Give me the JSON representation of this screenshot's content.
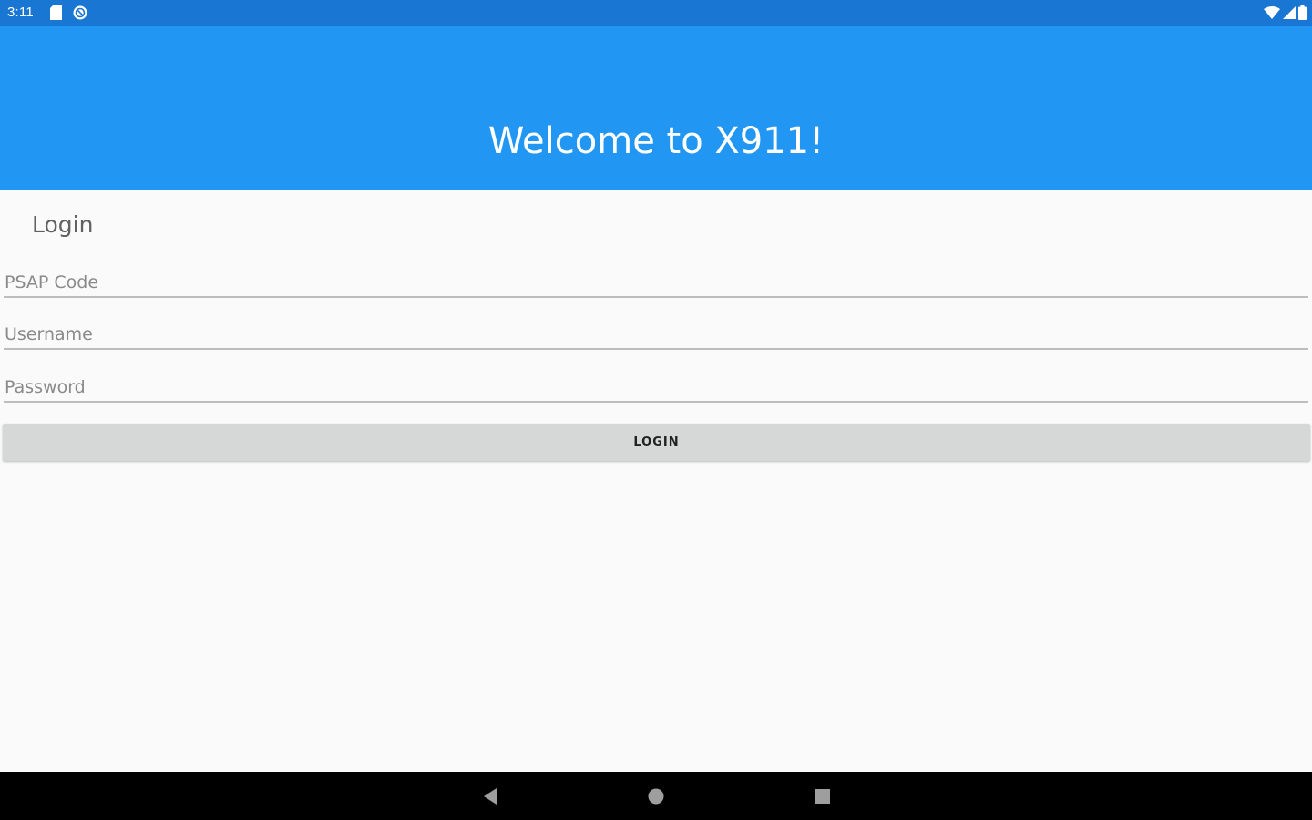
{
  "status_bar": {
    "time": "3:11",
    "left_icons": [
      "sd-card-icon",
      "blocked-icon"
    ],
    "right_icons": [
      "wifi-icon",
      "cellular-signal-icon",
      "battery-icon"
    ]
  },
  "app_bar": {
    "title": "Welcome to X911!"
  },
  "login_form": {
    "heading": "Login",
    "psap_code": {
      "placeholder": "PSAP Code",
      "value": ""
    },
    "username": {
      "placeholder": "Username",
      "value": ""
    },
    "password": {
      "placeholder": "Password",
      "value": ""
    },
    "submit_label": "LOGIN"
  },
  "nav_bar": {
    "buttons": [
      "back-icon",
      "home-icon",
      "recents-icon"
    ]
  },
  "colors": {
    "status_bar": "#1976d2",
    "app_bar": "#2196f3",
    "background": "#fafafa",
    "button": "#d6d7d7",
    "nav_bar": "#000000"
  }
}
